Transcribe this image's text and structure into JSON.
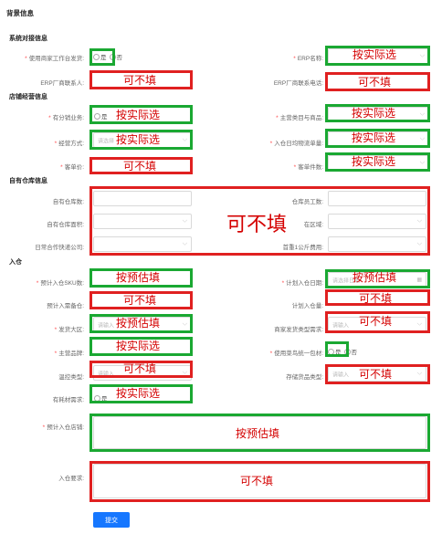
{
  "page_title": "背景信息",
  "sections": {
    "system": "系统对接信息",
    "store": "店铺经营信息",
    "warehouse": "自有仓库信息",
    "inbound": "入仓"
  },
  "fields": {
    "use_merchant_platform": "使用商家工作台发货:",
    "erp_name": "ERP名称:",
    "erp_contact": "ERP厂商联系人:",
    "erp_phone": "ERP厂商联系电话:",
    "distribution": "有分销业务:",
    "main_category": "主营类目与商品:",
    "business_mode": "经营方式:",
    "daily_volume": "入仓日均物流单量:",
    "unit_price": "客单价:",
    "unit_count": "客单件数:",
    "own_wh_count": "自有仓库数:",
    "wh_staff": "仓库员工数:",
    "own_wh_area": "自有仓库面积:",
    "wh_region": "在区域:",
    "daily_express": "日常合作快递公司:",
    "first_kg_fee": "首重1公斤费用:",
    "sku_count": "预计入仓SKU数:",
    "inbound_date": "计划入仓日期:",
    "prep_stock": "预计入需备仓:",
    "plan_qty": "计划入仓量:",
    "ship_region": "发货大区:",
    "ship_type": "商家发货类型需求:",
    "main_brand": "主营品牌:",
    "use_packaging": "使用菜鸟统一包材:",
    "temp_type": "温控类型:",
    "storage_type": "存储货品类型:",
    "consumables": "有耗材需求:",
    "inbound_store": "预计入仓店铺:",
    "inbound_req": "入仓要求:"
  },
  "radio": {
    "yes": "是",
    "no": "否"
  },
  "placeholders": {
    "select": "请选择",
    "input": "请输入",
    "date": "请选择日期"
  },
  "annotations": {
    "fill_actual": "按实际选",
    "fill_estimate": "按预估填",
    "optional": "可不填"
  },
  "submit": "提交",
  "colors": {
    "green": "#1aa832",
    "red": "#e02020",
    "primary": "#1677ff"
  }
}
